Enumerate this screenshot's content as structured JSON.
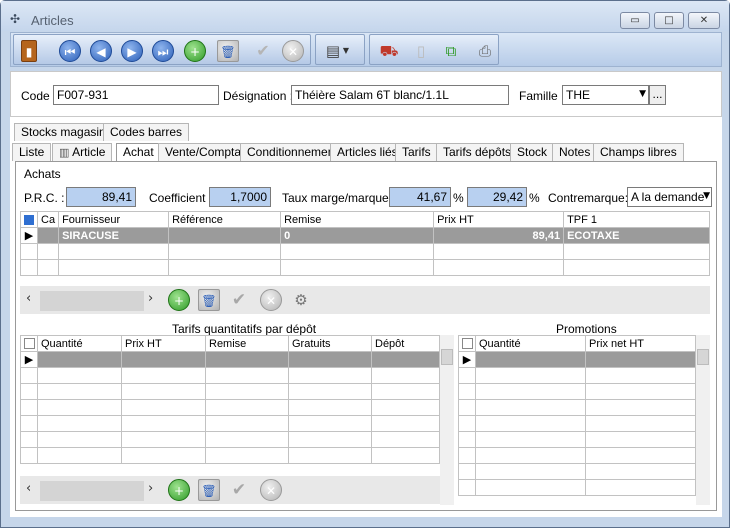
{
  "window": {
    "title": "Articles",
    "minimize": "▭",
    "restore": "□",
    "close": "✕"
  },
  "toolbar": {
    "icons": [
      "door-exit",
      "first",
      "previous",
      "next",
      "last",
      "add",
      "delete",
      "validate",
      "cancel",
      "print-menu",
      "order",
      "copy",
      "duplicate",
      "export"
    ]
  },
  "header": {
    "code_label": "Code :",
    "code_value": "F007-931",
    "designation_label": "Désignation :",
    "designation_value": "Théière Salam 6T blanc/1.1L",
    "famille_label": "Famille :",
    "famille_value": "THE",
    "famille_more": "..."
  },
  "tabs_row1": [
    "Stocks magasins",
    "Codes barres"
  ],
  "tabs_row2": [
    "Liste",
    "Article",
    "Achat",
    "Vente/Compta",
    "Conditionnement",
    "Articles liés",
    "Tarifs",
    "Tarifs dépôts",
    "Stock",
    "Notes",
    "Champs libres"
  ],
  "active_tab": "Achat",
  "achats": {
    "section": "Achats",
    "prc_label": "P.R.C. :",
    "prc_value": "89,41",
    "coef_label": "Coefficient :",
    "coef_value": "1,7000",
    "taux_label": "Taux marge/marque :",
    "taux_marge": "41,67",
    "pct1": "%",
    "taux_marque": "29,42",
    "pct2": "%",
    "contremarque_label": "Contremarque:",
    "contremarque_value": "A la demande"
  },
  "suppliers": {
    "columns": [
      "Ca",
      "Fournisseur",
      "Référence",
      "Remise",
      "Prix HT",
      "TPF 1"
    ],
    "rows": [
      {
        "ca": "",
        "fournisseur": "SIRACUSE",
        "reference": "",
        "remise": "0",
        "prix_ht": "89,41",
        "tpf": "ECOTAXE"
      }
    ]
  },
  "tarifs": {
    "title": "Tarifs quantitatifs par dépôt",
    "columns": [
      "Quantité",
      "Prix HT",
      "Remise",
      "Gratuits",
      "Dépôt"
    ]
  },
  "promotions": {
    "title": "Promotions",
    "columns": [
      "Quantité",
      "Prix net HT"
    ]
  }
}
